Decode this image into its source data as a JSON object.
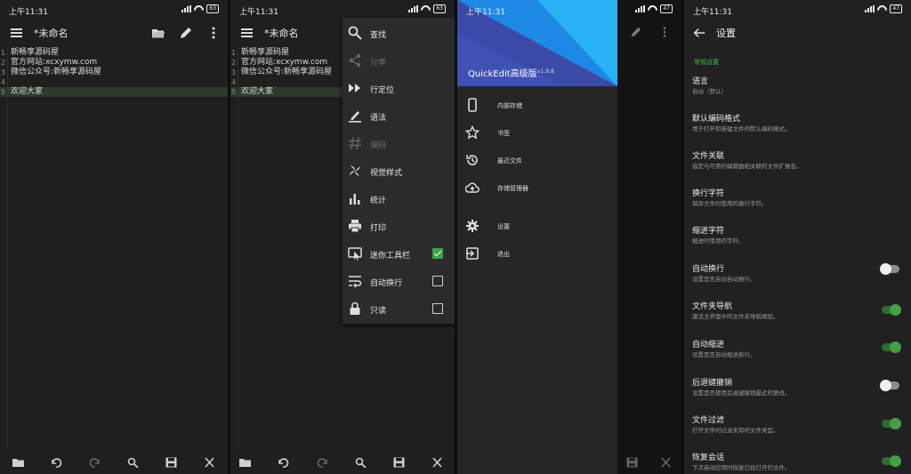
{
  "status": {
    "time": "上午11:31",
    "battery": "63",
    "battery_alt": "47"
  },
  "editor": {
    "title": "*未命名",
    "lines": [
      {
        "n": "1",
        "text": "新畅享源码屋"
      },
      {
        "n": "2",
        "text": "官方网站:xcxymw.com"
      },
      {
        "n": "3",
        "text": "微信公众号:新畅享源码屋"
      },
      {
        "n": "4",
        "text": ""
      },
      {
        "n": "5",
        "text": "欢迎大家"
      }
    ]
  },
  "menu": {
    "items": [
      {
        "label": "查找",
        "icon": "search-icon",
        "enabled": true
      },
      {
        "label": "分享",
        "icon": "share-icon",
        "enabled": false
      },
      {
        "label": "行定位",
        "icon": "goto-line-icon",
        "enabled": true
      },
      {
        "label": "语法",
        "icon": "syntax-icon",
        "enabled": true
      },
      {
        "label": "编码",
        "icon": "encoding-icon",
        "enabled": false
      },
      {
        "label": "视觉样式",
        "icon": "theme-icon",
        "enabled": true
      },
      {
        "label": "统计",
        "icon": "stats-icon",
        "enabled": true
      },
      {
        "label": "打印",
        "icon": "print-icon",
        "enabled": true
      },
      {
        "label": "迷你工具栏",
        "icon": "mini-toolbar-icon",
        "enabled": true,
        "checked": true
      },
      {
        "label": "自动换行",
        "icon": "wrap-icon",
        "enabled": true,
        "checked": false
      },
      {
        "label": "只读",
        "icon": "lock-icon",
        "enabled": true,
        "checked": false
      }
    ]
  },
  "drawer": {
    "title": "QuickEdit高级版",
    "version": "v1.9.8",
    "items": [
      {
        "label": "内部存储",
        "icon": "phone-icon"
      },
      {
        "label": "书签",
        "icon": "star-icon"
      },
      {
        "label": "最近文件",
        "icon": "history-icon"
      },
      {
        "label": "存储管理器",
        "icon": "cloud-upload-icon"
      },
      {
        "label": "设置",
        "icon": "gear-icon"
      },
      {
        "label": "退出",
        "icon": "exit-icon"
      }
    ]
  },
  "settings": {
    "title": "设置",
    "section": "常规设置",
    "rows": [
      {
        "title": "语言",
        "subtitle": "自动（默认）"
      },
      {
        "title": "默认编码格式",
        "subtitle": "用于打开和新建文件的默认编码格式。"
      },
      {
        "title": "文件关联",
        "subtitle": "指定与可用的编辑器相关联的文件扩展名。"
      },
      {
        "title": "换行字符",
        "subtitle": "保存文件时使用的换行字符。"
      },
      {
        "title": "缩进字符",
        "subtitle": "缩进时使用的字符。"
      },
      {
        "title": "自动换行",
        "subtitle": "设置是否启动自动换行。",
        "toggle": false
      },
      {
        "title": "文件夹导航",
        "subtitle": "激活主界面中的文件夹导航顺层。",
        "toggle": true
      },
      {
        "title": "自动缩进",
        "subtitle": "设置是否自动缩进新行。",
        "toggle": true
      },
      {
        "title": "后退键撤销",
        "subtitle": "设置是否使用后退键撤销最近的更改。",
        "toggle": false
      },
      {
        "title": "文件过滤",
        "subtitle": "打开文件时过滤未知的文件类型。",
        "toggle": true
      },
      {
        "title": "恢复会话",
        "subtitle": "下次启动应用时恢复已经打开的文件。",
        "toggle": true
      }
    ]
  },
  "colors": {
    "accent": "#43a047",
    "highlight_line": "#2d3a2d",
    "drawer_header": "#3b4aa8"
  }
}
